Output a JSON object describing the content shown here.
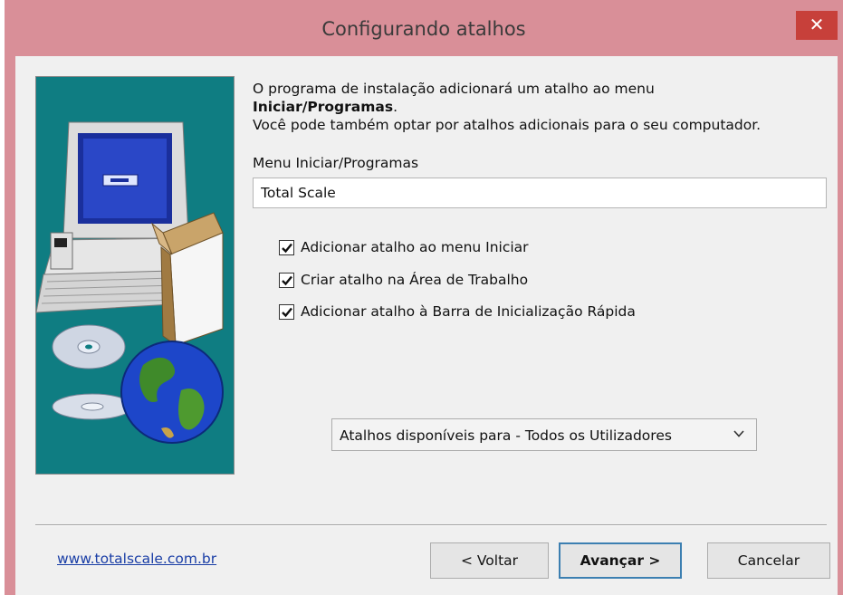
{
  "window": {
    "title": "Configurando atalhos",
    "close_glyph": "✕",
    "title_bar_color": "#d98f98"
  },
  "banner": {
    "background_color": "#0f7d82",
    "illustration": [
      "computer-icon",
      "cd-icon",
      "globe-icon",
      "box-icon"
    ]
  },
  "intro": {
    "line1": "O programa de instalação adicionará um atalho ao menu",
    "line2_bold": "Iniciar/Programas",
    "line2_suffix": ".",
    "line3": "Você pode também optar por atalhos adicionais para o seu computador."
  },
  "menu_field": {
    "label": "Menu Iniciar/Programas",
    "value": "Total Scale"
  },
  "options": [
    {
      "label": "Adicionar atalho ao menu Iniciar",
      "checked": true
    },
    {
      "label": "Criar atalho na Área de Trabalho",
      "checked": true
    },
    {
      "label": "Adicionar atalho à Barra de Inicialização Rápida",
      "checked": true
    }
  ],
  "availability_select": {
    "value": "Atalhos disponíveis para - Todos os Utilizadores"
  },
  "footer": {
    "link": "www.totalscale.com.br",
    "back_label": "< Voltar",
    "next_label": "Avançar >",
    "cancel_label": "Cancelar"
  }
}
